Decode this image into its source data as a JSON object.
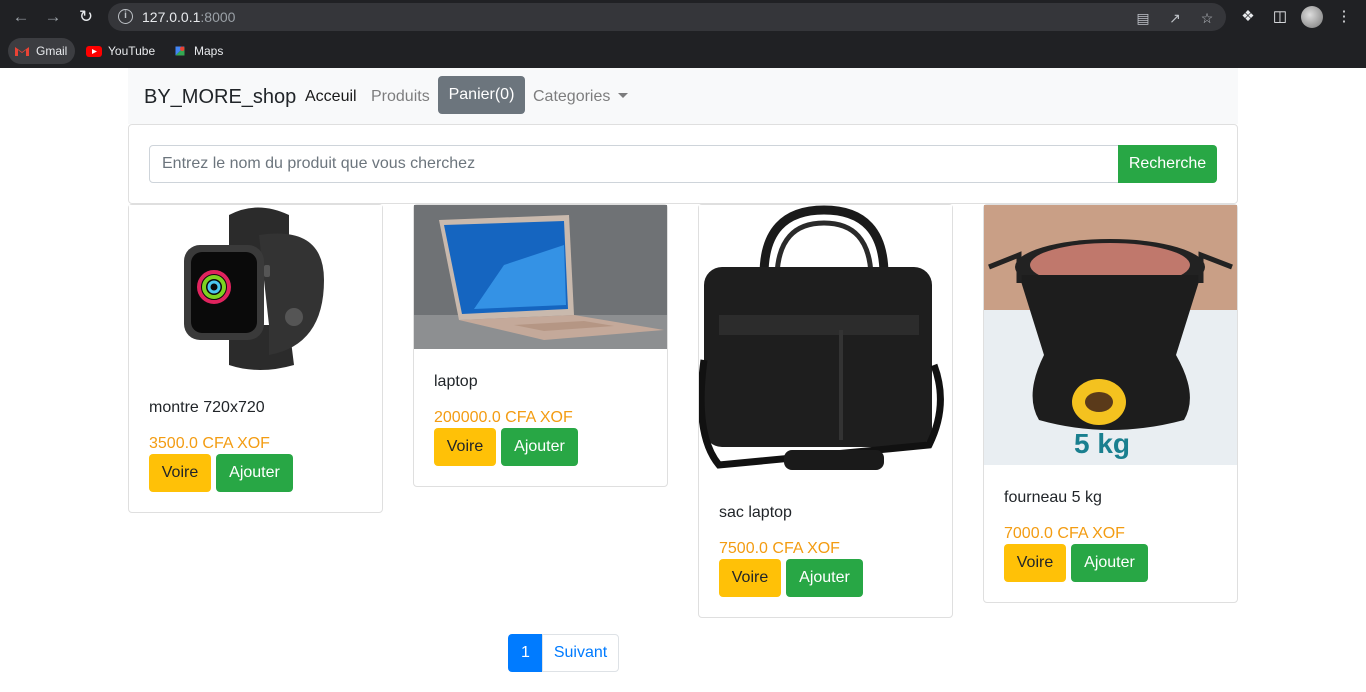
{
  "browser": {
    "url_host": "127.0.0.1",
    "url_port": ":8000",
    "bookmarks": [
      {
        "label": "Gmail"
      },
      {
        "label": "YouTube"
      },
      {
        "label": "Maps"
      }
    ]
  },
  "navbar": {
    "brand": "BY_MORE_shop",
    "home": "Acceuil",
    "products": "Produits",
    "cart": "Panier(0)",
    "categories": "Categories"
  },
  "search": {
    "placeholder": "Entrez le nom du produit que vous cherchez",
    "button": "Recherche"
  },
  "products": [
    {
      "title": "montre 720x720",
      "price": "3500.0 CFA XOF",
      "view": "Voire",
      "add": "Ajouter"
    },
    {
      "title": "laptop",
      "price": "200000.0 CFA XOF",
      "view": "Voire",
      "add": "Ajouter"
    },
    {
      "title": "sac laptop",
      "price": "7500.0 CFA XOF",
      "view": "Voire",
      "add": "Ajouter"
    },
    {
      "title": "fourneau 5 kg",
      "price": "7000.0 CFA XOF",
      "view": "Voire",
      "add": "Ajouter",
      "image_text": "5 kg"
    }
  ],
  "pagination": {
    "current": "1",
    "next": "Suivant"
  },
  "colors": {
    "primary": "#007bff",
    "success": "#28a745",
    "warning": "#ffc107",
    "price": "#f39c12",
    "secondary": "#6c757d"
  }
}
